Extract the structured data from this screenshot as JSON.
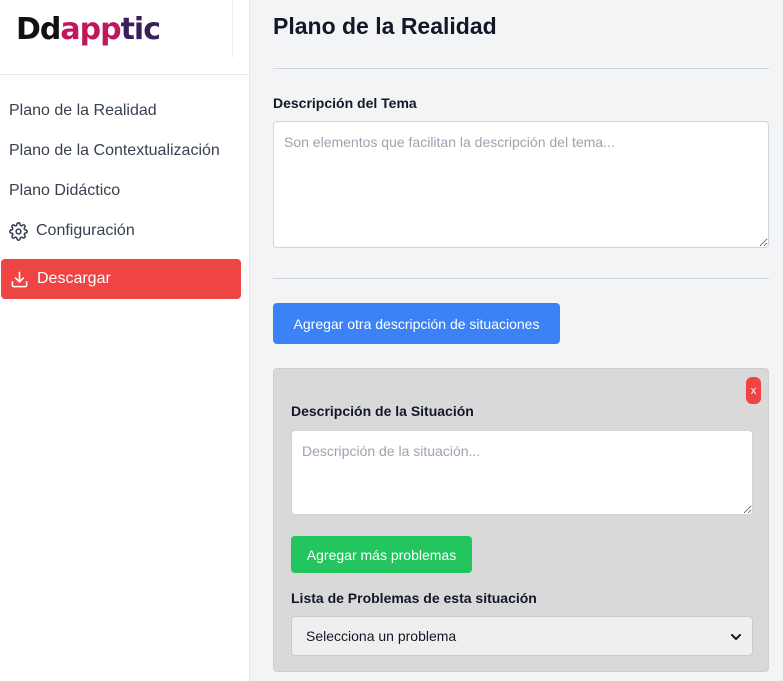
{
  "app": {
    "logo_parts": [
      "Dd",
      "a",
      "pp",
      "tic"
    ]
  },
  "sidebar": {
    "items": [
      {
        "label": "Plano de la Realidad"
      },
      {
        "label": "Plano de la Contextualización"
      },
      {
        "label": "Plano Didáctico"
      },
      {
        "label": "Configuración",
        "icon": "gear-icon"
      }
    ],
    "download": {
      "label": "Descargar",
      "icon": "download-icon",
      "color": "#ef4444"
    }
  },
  "main": {
    "title": "Plano de la Realidad",
    "topic": {
      "label": "Descripción del Tema",
      "placeholder": "Son elementos que facilitan la descripción del tema..."
    },
    "add_situation_button": {
      "label": "Agregar otra descripción de situaciones",
      "color": "#3b82f6"
    },
    "situation_card": {
      "close_label": "x",
      "label": "Descripción de la Situación",
      "placeholder": "Descripción de la situación...",
      "add_problems_button": {
        "label": "Agregar más problemas",
        "color": "#22c55e"
      },
      "problems_label": "Lista de Problemas de esta situación",
      "problems_select": {
        "selected": "Selecciona un problema"
      }
    }
  }
}
